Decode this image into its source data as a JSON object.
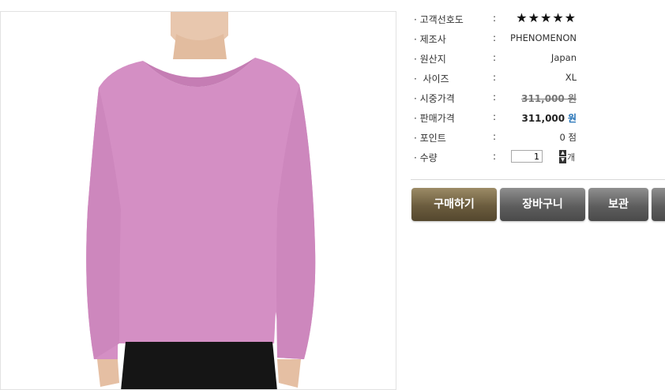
{
  "product": {
    "image_alt": "pink long sleeve scoop neck t-shirt"
  },
  "info": {
    "rows": [
      {
        "label": "· 고객선호도",
        "value": "★★★★★"
      },
      {
        "label": "· 제조사",
        "value": "PHENOMENON"
      },
      {
        "label": "· 원산지",
        "value": "Japan"
      },
      {
        "label": "·  사이즈",
        "value": "XL"
      },
      {
        "label": "· 시중가격",
        "value": "311,000 원"
      },
      {
        "label": "· 판매가격",
        "price": "311,000",
        "currency": "원"
      },
      {
        "label": "· 포인트",
        "value": "0 점"
      },
      {
        "label": "· 수량",
        "quantity": "1",
        "unit": "개"
      }
    ],
    "colon": ":"
  },
  "buttons": {
    "buy": "구매하기",
    "cart": "장바구니",
    "keep": "보관"
  },
  "colors": {
    "shirt": "#d48fc4",
    "buy_button": "#7a6a4a",
    "gray_button": "#5e5e5e",
    "currency_blue": "#1f6fb5"
  }
}
